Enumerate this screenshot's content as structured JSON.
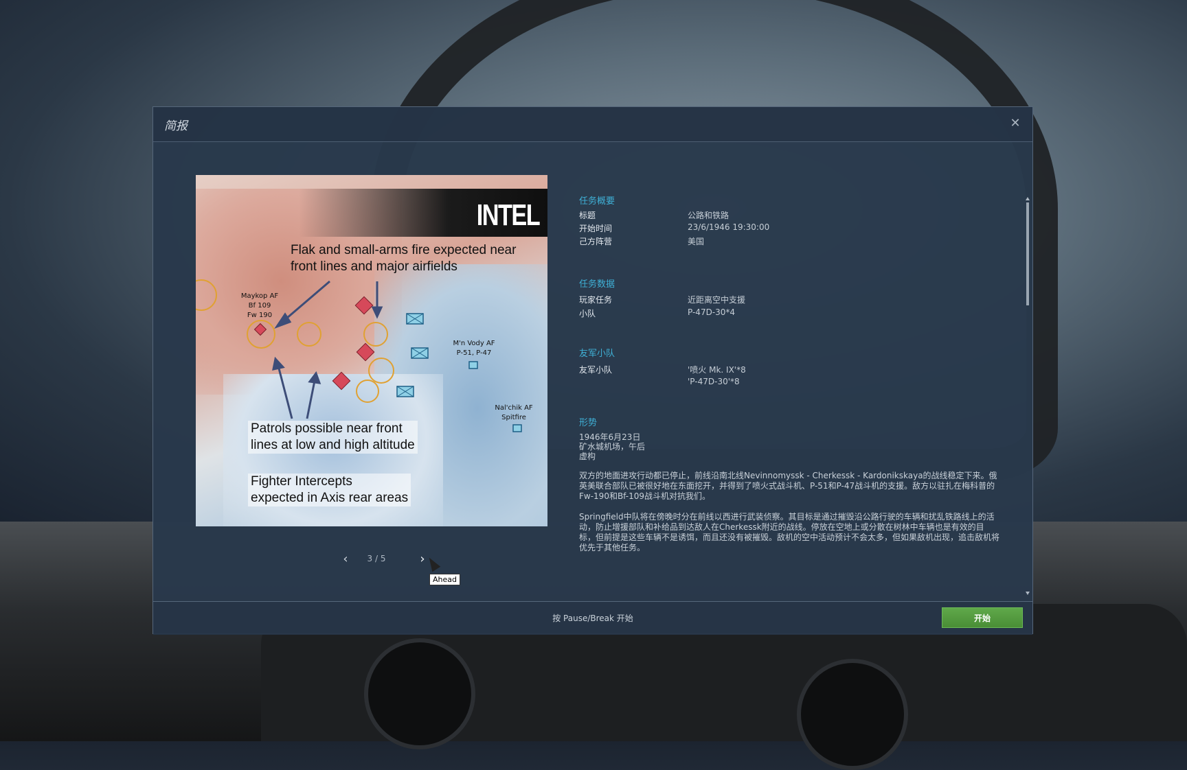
{
  "dialog": {
    "title": "简报",
    "close_label": "✕"
  },
  "briefing_image": {
    "badge": "INTEL",
    "note_flak_1": "Flak and small-arms fire expected near",
    "note_flak_2": "front lines and major airfields",
    "note_patrol_1": "Patrols possible near front",
    "note_patrol_2": "lines at low and high altitude",
    "note_fighter_1": "Fighter Intercepts",
    "note_fighter_2": "expected in Axis rear areas",
    "label_maykop_1": "Maykop AF",
    "label_maykop_2": "Bf 109",
    "label_maykop_3": "Fw 190",
    "label_mnvody_1": "M'n Vody AF",
    "label_mnvody_2": "P-51, P-47",
    "label_nalchik_1": "Nal'chik AF",
    "label_nalchik_2": "Spitfire"
  },
  "pager": {
    "prev_label": "‹",
    "next_label": "›",
    "text": "3 / 5",
    "tooltip": "Ahead"
  },
  "summary": {
    "section": "任务概要",
    "title_label": "标题",
    "title_value": "公路和铁路",
    "start_label": "开始时间",
    "start_value": "23/6/1946  19:30:00",
    "side_label": "己方阵营",
    "side_value": "美国"
  },
  "mission_data": {
    "section": "任务数据",
    "task_label": "玩家任务",
    "task_value": "近距离空中支援",
    "flight_label": "小队",
    "flight_value": "P-47D-30*4"
  },
  "friendly": {
    "section": "友军小队",
    "label": "友军小队",
    "value_1": "'喷火 Mk. IX'*8",
    "value_2": "'P-47D-30'*8"
  },
  "situation": {
    "section": "形势",
    "line_1": "1946年6月23日",
    "line_2": "矿水城机场，午后",
    "line_3": "虚构",
    "para_1": "双方的地面进攻行动都已停止，前线沿南北线Nevinnomyssk - Cherkessk - Kardonikskaya的战线稳定下来。俄英美联合部队已被很好地在东面挖开，并得到了喷火式战斗机、P-51和P-47战斗机的支援。敌方以驻扎在梅科普的Fw-190和Bf-109战斗机对抗我们。",
    "para_2": "Springfield中队将在傍晚时分在前线以西进行武装侦察。其目标是通过摧毁沿公路行驶的车辆和扰乱铁路线上的活动，防止增援部队和补给品到达敌人在Cherkessk附近的战线。停放在空地上或分散在树林中车辆也是有效的目标，但前提是这些车辆不是诱饵，而且还没有被摧毁。敌机的空中活动预计不会太多，但如果敌机出现，追击敌机将优先于其他任务。"
  },
  "footer": {
    "hint": "按 Pause/Break 开始",
    "start_label": "开始"
  },
  "colors": {
    "accent": "#3fb0d6",
    "start_button": "#4f9a3c"
  }
}
